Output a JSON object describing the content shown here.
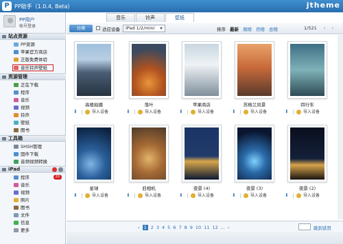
{
  "app": {
    "title": "PP助手（1.0.4, Beta）",
    "watermark": "jtheme"
  },
  "tabs": [
    {
      "label": "音乐"
    },
    {
      "label": "铃声"
    },
    {
      "label": "壁纸"
    }
  ],
  "user": {
    "name": "PP用户",
    "login": "帐号登录"
  },
  "sidebar": {
    "sections": [
      {
        "label": "站点资源",
        "items": [
          {
            "label": "PP资源"
          },
          {
            "label": "苹果官方商店"
          },
          {
            "label": "正版免费体验"
          },
          {
            "label": "音乐铃声壁纸"
          }
        ]
      },
      {
        "label": "资源管理",
        "items": [
          {
            "label": "正在下载"
          },
          {
            "label": "程序"
          },
          {
            "label": "音乐"
          },
          {
            "label": "视频"
          },
          {
            "label": "铃声"
          },
          {
            "label": "壁纸"
          },
          {
            "label": "图书"
          }
        ]
      },
      {
        "label": "工具箱",
        "items": [
          {
            "label": "SHSH管理"
          },
          {
            "label": "固件下载"
          },
          {
            "label": "音频视频转换"
          }
        ]
      },
      {
        "label": "iPad",
        "items": [
          {
            "label": "程序",
            "badge": "20"
          },
          {
            "label": "音乐"
          },
          {
            "label": "视频"
          },
          {
            "label": "照片"
          },
          {
            "label": "图书"
          },
          {
            "label": "文件"
          },
          {
            "label": "信息"
          },
          {
            "label": "更多"
          }
        ]
      }
    ]
  },
  "toolbar": {
    "category": "分类",
    "fit_label": "适应设备",
    "device": "iPad 1/2/mini",
    "sort_label": "排序",
    "sort_options": [
      "最新",
      "周榜",
      "月榜",
      "总榜"
    ],
    "page_count": "1/521"
  },
  "wallpapers": [
    {
      "caption": "高楼拍摄",
      "action": "导入设备"
    },
    {
      "caption": "落叶",
      "action": "导入设备"
    },
    {
      "caption": "苹果商店",
      "action": "导入设备"
    },
    {
      "caption": "苏格兰风景",
      "action": "导入设备"
    },
    {
      "caption": "四行车",
      "action": "导入设备"
    },
    {
      "caption": "星球",
      "action": "导入设备"
    },
    {
      "caption": "旧相机",
      "action": "导入设备"
    },
    {
      "caption": "夜景 (4)",
      "action": "导入设备"
    },
    {
      "caption": "夜景 (3)",
      "action": "导入设备"
    },
    {
      "caption": "夜景 (2)",
      "action": "导入设备"
    }
  ],
  "pager": {
    "prev": "‹",
    "pages": [
      "1",
      "2",
      "3",
      "4",
      "5",
      "6",
      "7",
      "8",
      "9",
      "10",
      "11",
      "12"
    ],
    "ellipsis": "...",
    "next": "›",
    "goto": "跳到该页"
  },
  "colors": {
    "accent": "#3a7cbd",
    "badge": "#d42020",
    "selection_outline": "#d02020"
  }
}
